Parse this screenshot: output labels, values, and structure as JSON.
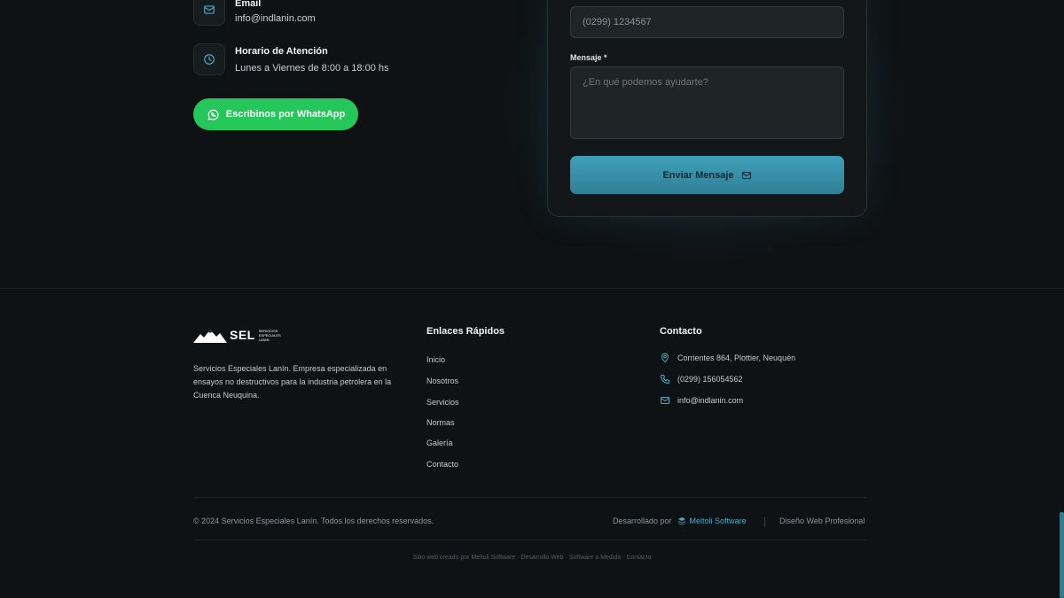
{
  "contact_info": {
    "email_title": "Email",
    "email_value": "info@indlanin.com",
    "hours_title": "Horario de Atención",
    "hours_value": "Lunes a Viernes de 8:00 a 18:00 hs",
    "whatsapp_label": "Escribinos por WhatsApp"
  },
  "form": {
    "phone_value": "(0299) 1234567",
    "message_label": "Mensaje *",
    "message_placeholder": "¿En qué podemos ayudarte?",
    "submit_label": "Enviar Mensaje"
  },
  "footer": {
    "logo_text": "SEL",
    "logo_subtext": [
      "SERVICIOS",
      "ESPECIALES",
      "LANIN"
    ],
    "description": "Servicios Especiales Lanín. Empresa especializada en ensayos no destructivos para la industria petrolera en la Cuenca Neuquina.",
    "quick_links_title": "Enlaces Rápidos",
    "quick_links": [
      "Inicio",
      "Nosotros",
      "Servicios",
      "Normas",
      "Galería",
      "Contacto"
    ],
    "contact_title": "Contacto",
    "address": "Corrientes 864, Plottier, Neuquén",
    "phone": "(0299) 156054562",
    "email": "info@indlanin.com",
    "copyright": "© 2024 Servicios Especiales Lanín. Todos los derechos reservados.",
    "developed_by": "Desarrollado por",
    "developer_name": "Meltoli Software",
    "design_label": "Diseño Web Profesional",
    "bottom_line": "Sitio web creado por Meltoli Software · Desarrollo Web · Software a Medida · Contacto"
  },
  "colors": {
    "background": "#0f1214",
    "whatsapp_green": "#25c65a",
    "accent_teal": "#3f9fb8",
    "brand_link": "#47a8c4"
  },
  "icons": {
    "email": "mail-icon",
    "hours": "clock-icon",
    "whatsapp": "whatsapp-icon",
    "submit": "mail-icon",
    "address": "map-pin-icon",
    "phone": "phone-icon",
    "developer": "layers-icon"
  }
}
